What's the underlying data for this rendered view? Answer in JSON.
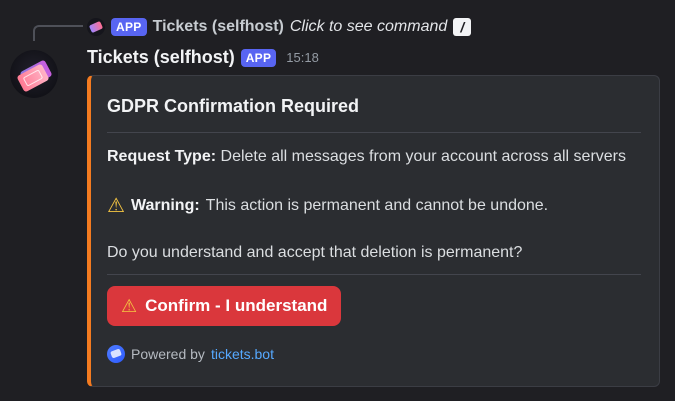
{
  "reply": {
    "app_badge": "APP",
    "name": "Tickets (selfhost)",
    "command_hint": "Click to see command",
    "command_icon": "slash-command-icon"
  },
  "message": {
    "username": "Tickets (selfhost)",
    "app_badge": "APP",
    "timestamp": "15:18",
    "avatar_icon": "ticket-avatar"
  },
  "embed": {
    "accent_color": "#f47b20",
    "title": "GDPR Confirmation Required",
    "request_label": "Request Type:",
    "request_value": "Delete all messages from your account across all servers",
    "warning_icon": "warning-icon",
    "warning_label": "Warning:",
    "warning_value": "This action is permanent and cannot be undone.",
    "question": "Do you understand and accept that deletion is permanent?",
    "button": {
      "label": "Confirm - I understand",
      "icon": "warning-icon",
      "color": "#da373c"
    },
    "footer": {
      "prefix": "Powered by",
      "link": "tickets.bot",
      "icon": "tickets-bot-icon"
    }
  }
}
